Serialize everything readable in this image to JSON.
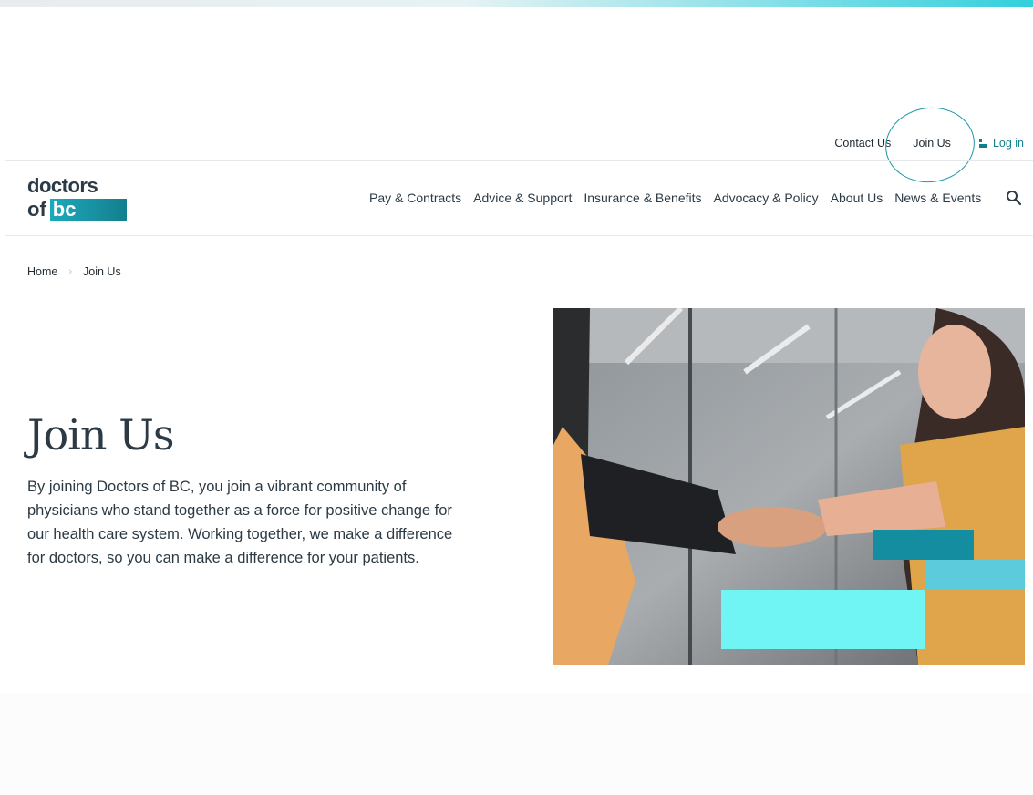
{
  "utility_nav": {
    "contact": "Contact Us",
    "join": "Join Us",
    "login": "Log in"
  },
  "logo": {
    "line1": "doctors",
    "line2a": "of",
    "line2b": "bc"
  },
  "main_nav": [
    "Pay & Contracts",
    "Advice & Support",
    "Insurance & Benefits",
    "Advocacy & Policy",
    "About Us",
    "News & Events"
  ],
  "breadcrumb": [
    "Home",
    "Join Us"
  ],
  "page": {
    "title": "Join Us",
    "intro": "By joining Doctors of BC, you join a vibrant community of physicians who stand together as a force for positive change for our health care system. Working together, we make a difference for doctors, so you can make a difference for your patients."
  },
  "colors": {
    "accent": "#0f7f8e",
    "highlight": "#70f4f4",
    "brand_teal": "#1f97a8"
  },
  "icons": {
    "search": "search-icon",
    "user": "user-icon",
    "chevron": "chevron-right-icon"
  }
}
